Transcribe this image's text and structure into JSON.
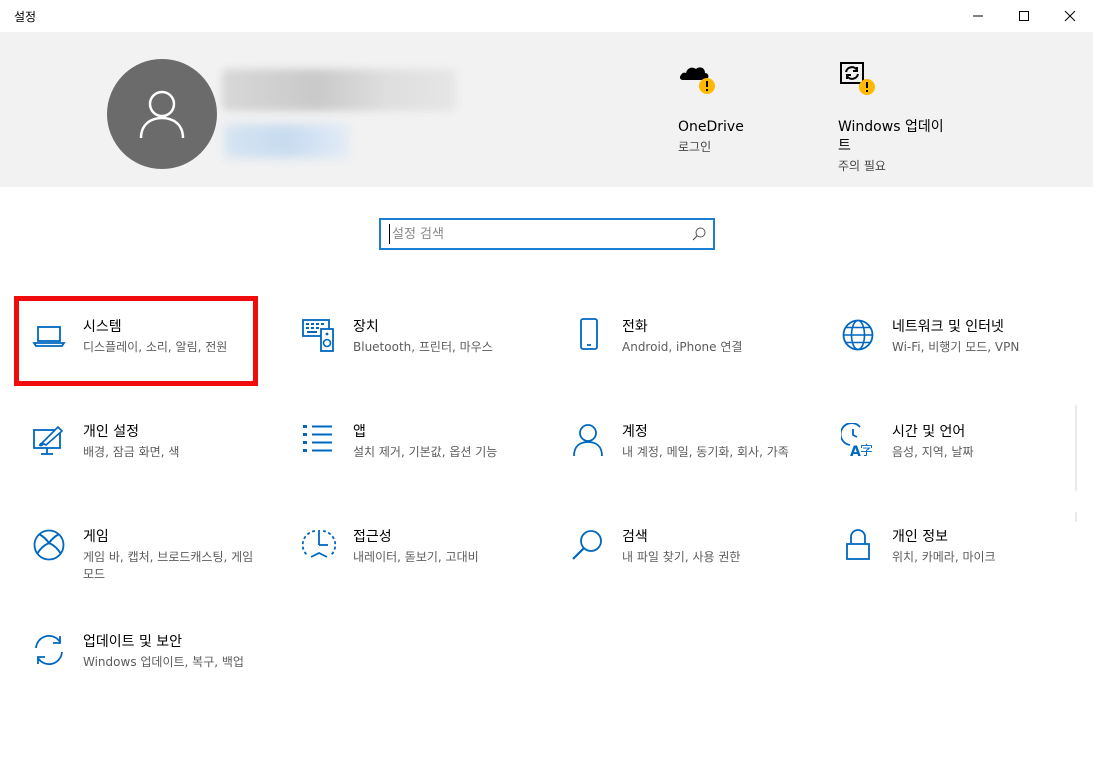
{
  "window": {
    "title": "설정"
  },
  "header": {
    "onedrive": {
      "label": "OneDrive",
      "sub": "로그인"
    },
    "windows_update": {
      "label": "Windows 업데이트",
      "sub": "주의 필요"
    }
  },
  "search": {
    "placeholder": "설정 검색",
    "value": ""
  },
  "colors": {
    "accent": "#0067c0",
    "highlight": "#f00c0c",
    "warning": "#ffb900"
  },
  "categories": [
    {
      "icon": "laptop-icon",
      "title": "시스템",
      "desc": "디스플레이, 소리, 알림, 전원"
    },
    {
      "icon": "keyboard-device-icon",
      "title": "장치",
      "desc": "Bluetooth, 프린터, 마우스"
    },
    {
      "icon": "phone-icon",
      "title": "전화",
      "desc": "Android, iPhone 연결"
    },
    {
      "icon": "globe-icon",
      "title": "네트워크 및 인터넷",
      "desc": "Wi-Fi, 비행기 모드, VPN"
    },
    {
      "icon": "personalization-icon",
      "title": "개인 설정",
      "desc": "배경, 잠금 화면, 색"
    },
    {
      "icon": "apps-list-icon",
      "title": "앱",
      "desc": "설치 제거, 기본값, 옵션 기능"
    },
    {
      "icon": "person-icon",
      "title": "계정",
      "desc": "내 계정, 메일, 동기화, 회사, 가족"
    },
    {
      "icon": "time-language-icon",
      "title": "시간 및 언어",
      "desc": "음성, 지역, 날짜"
    },
    {
      "icon": "xbox-icon",
      "title": "게임",
      "desc": "게임 바, 캡처, 브로드캐스팅, 게임 모드"
    },
    {
      "icon": "ease-of-access-icon",
      "title": "접근성",
      "desc": "내레이터, 돋보기, 고대비"
    },
    {
      "icon": "search-icon",
      "title": "검색",
      "desc": "내 파일 찾기, 사용 권한"
    },
    {
      "icon": "lock-icon",
      "title": "개인 정보",
      "desc": "위치, 카메라, 마이크"
    },
    {
      "icon": "sync-icon",
      "title": "업데이트 및 보안",
      "desc": "Windows 업데이트, 복구, 백업"
    }
  ]
}
